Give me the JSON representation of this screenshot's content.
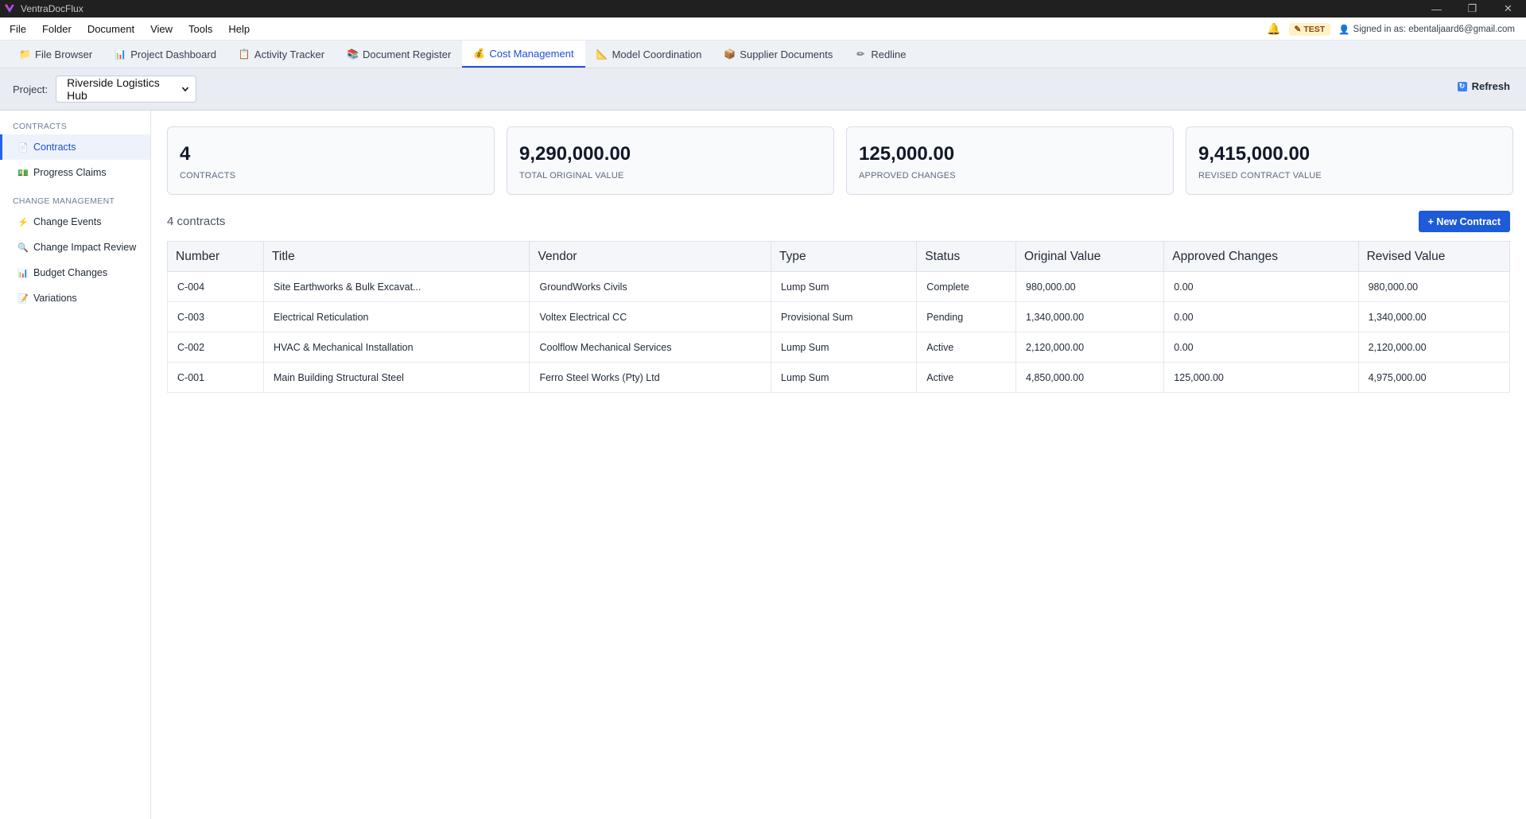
{
  "window": {
    "title": "VentraDocFlux",
    "controls": [
      "minimize-icon",
      "restore-icon",
      "close-icon"
    ]
  },
  "menu": {
    "items": [
      "File",
      "Folder",
      "Document",
      "View",
      "Tools",
      "Help"
    ],
    "env_badge": "TEST",
    "signed_in": "Signed in as: ebentaljaard6@gmail.com"
  },
  "tabs": [
    {
      "label": "File Browser",
      "icon": "folder-icon",
      "glyph": "📁"
    },
    {
      "label": "Project Dashboard",
      "icon": "bar-chart-icon",
      "glyph": "📊"
    },
    {
      "label": "Activity Tracker",
      "icon": "clipboard-icon",
      "glyph": "📋"
    },
    {
      "label": "Document Register",
      "icon": "books-icon",
      "glyph": "📚"
    },
    {
      "label": "Cost Management",
      "icon": "money-bag-icon",
      "glyph": "💰",
      "active": true
    },
    {
      "label": "Model Coordination",
      "icon": "ruler-icon",
      "glyph": "📐"
    },
    {
      "label": "Supplier Documents",
      "icon": "package-icon",
      "glyph": "📦"
    },
    {
      "label": "Redline",
      "icon": "pencil-icon",
      "glyph": "✏"
    }
  ],
  "project": {
    "label": "Project:",
    "selected": "Riverside Logistics Hub",
    "refresh_label": "Refresh"
  },
  "sidebar": {
    "sections": [
      {
        "heading": "CONTRACTS",
        "items": [
          {
            "label": "Contracts",
            "icon": "document-icon",
            "glyph": "📄",
            "active": true
          },
          {
            "label": "Progress Claims",
            "icon": "money-icon",
            "glyph": "💵"
          }
        ]
      },
      {
        "heading": "CHANGE MANAGEMENT",
        "items": [
          {
            "label": "Change Events",
            "icon": "lightning-icon",
            "glyph": "⚡"
          },
          {
            "label": "Change Impact Review",
            "icon": "magnifier-icon",
            "glyph": "🔍"
          },
          {
            "label": "Budget Changes",
            "icon": "bar-chart-icon",
            "glyph": "📊"
          },
          {
            "label": "Variations",
            "icon": "memo-icon",
            "glyph": "📝"
          }
        ]
      }
    ]
  },
  "summary_cards": [
    {
      "value": "4",
      "label": "CONTRACTS"
    },
    {
      "value": "9,290,000.00",
      "label": "TOTAL ORIGINAL VALUE"
    },
    {
      "value": "125,000.00",
      "label": "APPROVED CHANGES"
    },
    {
      "value": "9,415,000.00",
      "label": "REVISED CONTRACT VALUE"
    }
  ],
  "contracts": {
    "count_text": "4 contracts",
    "new_button": "+ New Contract",
    "columns": [
      "Number",
      "Title",
      "Vendor",
      "Type",
      "Status",
      "Original Value",
      "Approved Changes",
      "Revised Value"
    ],
    "rows": [
      [
        "C-004",
        "Site Earthworks & Bulk Excavat...",
        "GroundWorks Civils",
        "Lump Sum",
        "Complete",
        "980,000.00",
        "0.00",
        "980,000.00"
      ],
      [
        "C-003",
        "Electrical Reticulation",
        "Voltex Electrical CC",
        "Provisional Sum",
        "Pending",
        "1,340,000.00",
        "0.00",
        "1,340,000.00"
      ],
      [
        "C-002",
        "HVAC & Mechanical Installation",
        "Coolflow Mechanical Services",
        "Lump Sum",
        "Active",
        "2,120,000.00",
        "0.00",
        "2,120,000.00"
      ],
      [
        "C-001",
        "Main Building Structural Steel",
        "Ferro Steel Works (Pty) Ltd",
        "Lump Sum",
        "Active",
        "4,850,000.00",
        "125,000.00",
        "4,975,000.00"
      ]
    ]
  }
}
